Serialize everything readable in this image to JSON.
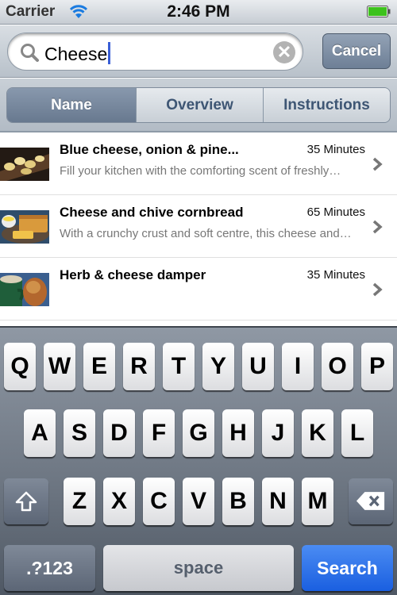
{
  "status_bar": {
    "carrier": "Carrier",
    "time": "2:46 PM",
    "wifi_icon": "wifi-icon",
    "battery_icon": "battery-icon",
    "battery_level": 1.0
  },
  "search": {
    "value": "Cheese",
    "search_icon": "magnifier-icon",
    "clear_icon": "clear-icon",
    "clear_glyph": "✕",
    "cancel_label": "Cancel"
  },
  "scope": {
    "tabs": [
      {
        "label": "Name",
        "selected": true
      },
      {
        "label": "Overview",
        "selected": false
      },
      {
        "label": "Instructions",
        "selected": false
      }
    ]
  },
  "results": [
    {
      "title": "Blue cheese, onion & pine...",
      "time": "35 Minutes",
      "description": "Fill your kitchen with the comforting scent of freshly…"
    },
    {
      "title": "Cheese and chive cornbread",
      "time": "65 Minutes",
      "description": "With a crunchy crust and soft centre, this cheese and…"
    },
    {
      "title": "Herb & cheese damper",
      "time": "35 Minutes",
      "description": ""
    }
  ],
  "keyboard": {
    "row1": [
      "Q",
      "W",
      "E",
      "R",
      "T",
      "Y",
      "U",
      "I",
      "O",
      "P"
    ],
    "row2": [
      "A",
      "S",
      "D",
      "F",
      "G",
      "H",
      "J",
      "K",
      "L"
    ],
    "row3": [
      "Z",
      "X",
      "C",
      "V",
      "B",
      "N",
      "M"
    ],
    "shift_icon": "shift-icon",
    "backspace_icon": "backspace-icon",
    "numbers_label": ".?123",
    "space_label": "space",
    "search_label": "Search"
  },
  "colors": {
    "accent_blue": "#1a5fe0",
    "caret": "#3a5fd6",
    "selected_segment": "#68798f"
  }
}
